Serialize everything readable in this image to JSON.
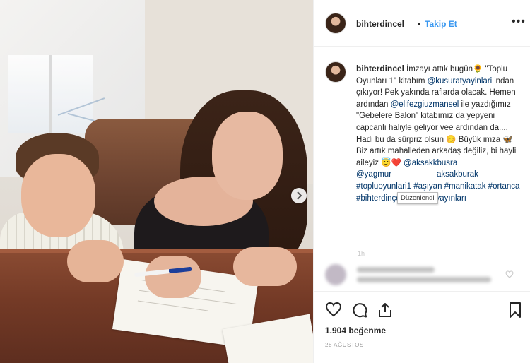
{
  "post": {
    "username": "bihterdincel",
    "follow_label": "Takip Et",
    "dot": "•",
    "more_label": "•••"
  },
  "caption": {
    "username": "bihterdincel",
    "t1": "İmzayı attık bugün",
    "e1": "🌻",
    "t2": " \"Toplu Oyunları 1\" kitabım ",
    "m1": "@kusuratyayinlari",
    "t3": " 'ndan çıkıyor! Pek yakında raflarda olacak. Hemen ardından ",
    "m2": "@elifezgiuzmansel",
    "t4": " ile yazdığımız \"Gebelere Balon\" kitabımız da yepyeni capcanlı haliyle geliyor vee ardından da.... Hadi bu da sürpriz olsun ",
    "e2": "😊",
    "t5": " Büyük imza ",
    "e3": "🦋",
    "t6": " Biz artık mahalleden arkadaş değiliz, bi hayli aileyiz ",
    "e4": "😇",
    "e5": "❤️",
    "t7": " ",
    "m3": "@aksakkbusra",
    "t8": " ",
    "m4": "@yagmur",
    "m5": "aksakburak",
    "tags": "#topluoyunlari1 #aşıyan #manikatak #ortanca #bihterdinçel #küsuratyayınları"
  },
  "tooltip": "Düzenlendi",
  "caption_time": "1h",
  "actions": {
    "heart_icon": "heart-icon",
    "comment_icon": "comment-icon",
    "share_icon": "share-icon",
    "save_icon": "bookmark-icon"
  },
  "likes": "1.904 beğenme",
  "date": "28 AĞUSTOS",
  "colors": {
    "link": "#003569",
    "follow": "#3897f0",
    "text": "#262626",
    "muted": "#999999"
  }
}
